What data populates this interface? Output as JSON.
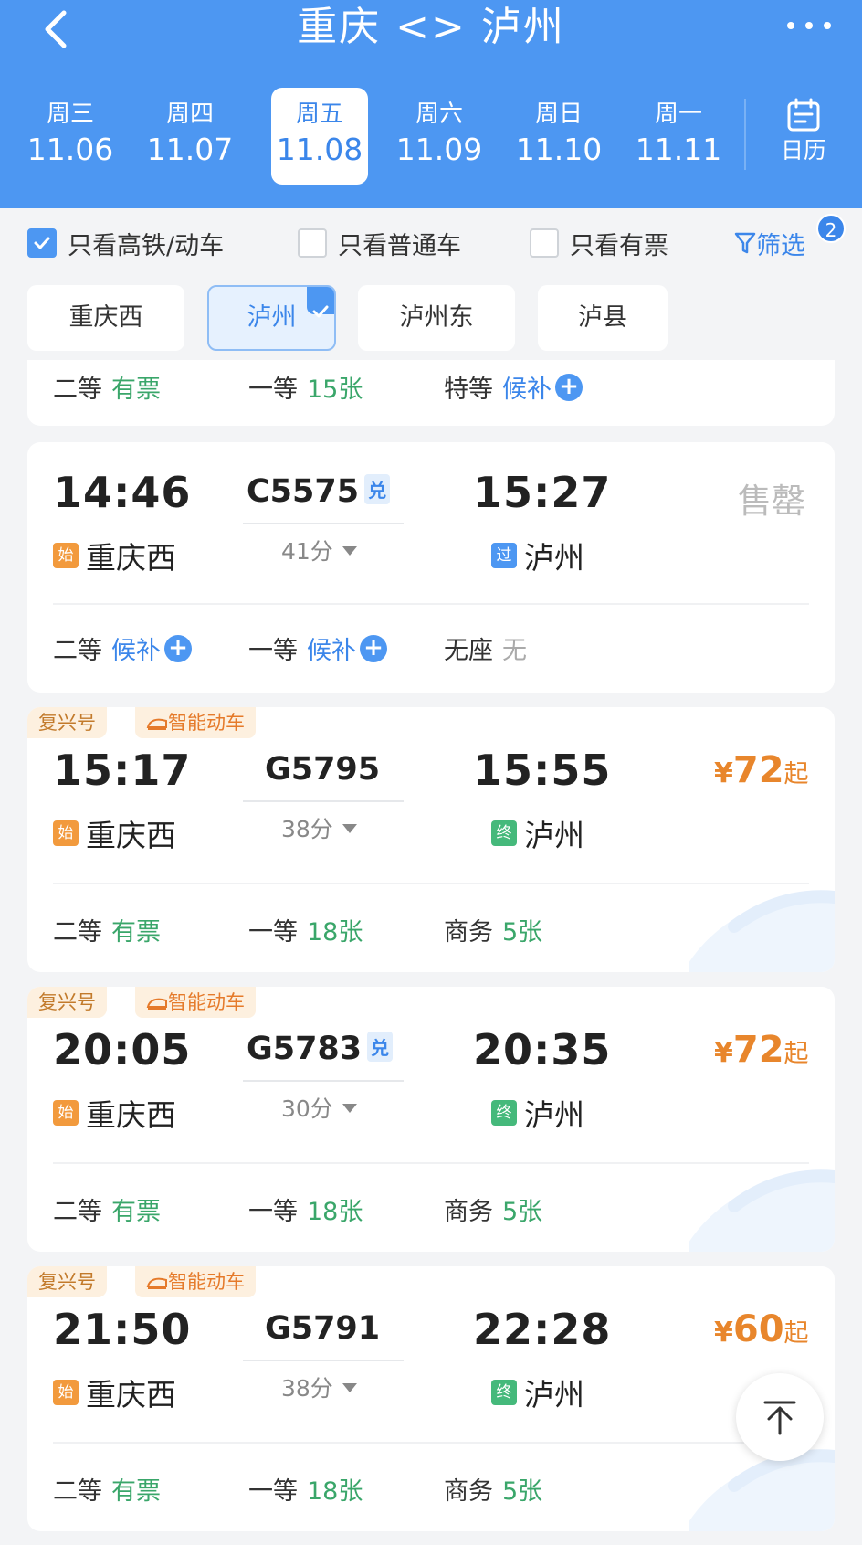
{
  "header": {
    "title": "重庆 <> 泸州",
    "dates": [
      {
        "weekday": "周三",
        "date": "11.06"
      },
      {
        "weekday": "周四",
        "date": "11.07"
      },
      {
        "weekday": "周五",
        "date": "11.08"
      },
      {
        "weekday": "周六",
        "date": "11.09"
      },
      {
        "weekday": "周日",
        "date": "11.10"
      },
      {
        "weekday": "周一",
        "date": "11.11"
      }
    ],
    "calendar_label": "日历"
  },
  "filters": {
    "high_speed": "只看高铁/动车",
    "normal": "只看普通车",
    "available": "只看有票",
    "filter_label": "筛选",
    "filter_count": "2"
  },
  "stations": [
    "重庆西",
    "泸州",
    "泸州东",
    "泸县"
  ],
  "partial_card": {
    "s1_name": "二等",
    "s1_val": "有票",
    "s2_name": "一等",
    "s2_val": "15张",
    "s3_name": "特等",
    "s3_val": "候补"
  },
  "trains": [
    {
      "dep": "14:46",
      "train_no": "C5575",
      "dui": "兑",
      "arr": "15:27",
      "duration": "41分",
      "from_tag": "始",
      "from": "重庆西",
      "to_tag": "过",
      "to": "泸州",
      "sold_out": "售罄",
      "s1_name": "二等",
      "s1_val": "候补",
      "s2_name": "一等",
      "s2_val": "候补",
      "s3_name": "无座",
      "s3_val": "无"
    },
    {
      "badge1": "复兴号",
      "badge2": "智能动车",
      "dep": "15:17",
      "train_no": "G5795",
      "arr": "15:55",
      "duration": "38分",
      "from_tag": "始",
      "from": "重庆西",
      "to_tag": "终",
      "to": "泸州",
      "price_yen": "¥",
      "price": "72",
      "price_suffix": "起",
      "s1_name": "二等",
      "s1_val": "有票",
      "s2_name": "一等",
      "s2_val": "18张",
      "s3_name": "商务",
      "s3_val": "5张"
    },
    {
      "badge1": "复兴号",
      "badge2": "智能动车",
      "dep": "20:05",
      "train_no": "G5783",
      "dui": "兑",
      "arr": "20:35",
      "duration": "30分",
      "from_tag": "始",
      "from": "重庆西",
      "to_tag": "终",
      "to": "泸州",
      "price_yen": "¥",
      "price": "72",
      "price_suffix": "起",
      "s1_name": "二等",
      "s1_val": "有票",
      "s2_name": "一等",
      "s2_val": "18张",
      "s3_name": "商务",
      "s3_val": "5张"
    },
    {
      "badge1": "复兴号",
      "badge2": "智能动车",
      "dep": "21:50",
      "train_no": "G5791",
      "arr": "22:28",
      "duration": "38分",
      "from_tag": "始",
      "from": "重庆西",
      "to_tag": "终",
      "to": "泸州",
      "price_yen": "¥",
      "price": "60",
      "price_suffix": "起",
      "s1_name": "二等",
      "s1_val": "有票",
      "s2_name": "一等",
      "s2_val": "18张",
      "s3_name": "商务",
      "s3_val": "5张"
    }
  ],
  "colors": {
    "header_bg": "#4d97f2",
    "accent_blue": "#3b86ea",
    "available_green": "#3aa66a",
    "price_orange": "#e8862c"
  }
}
